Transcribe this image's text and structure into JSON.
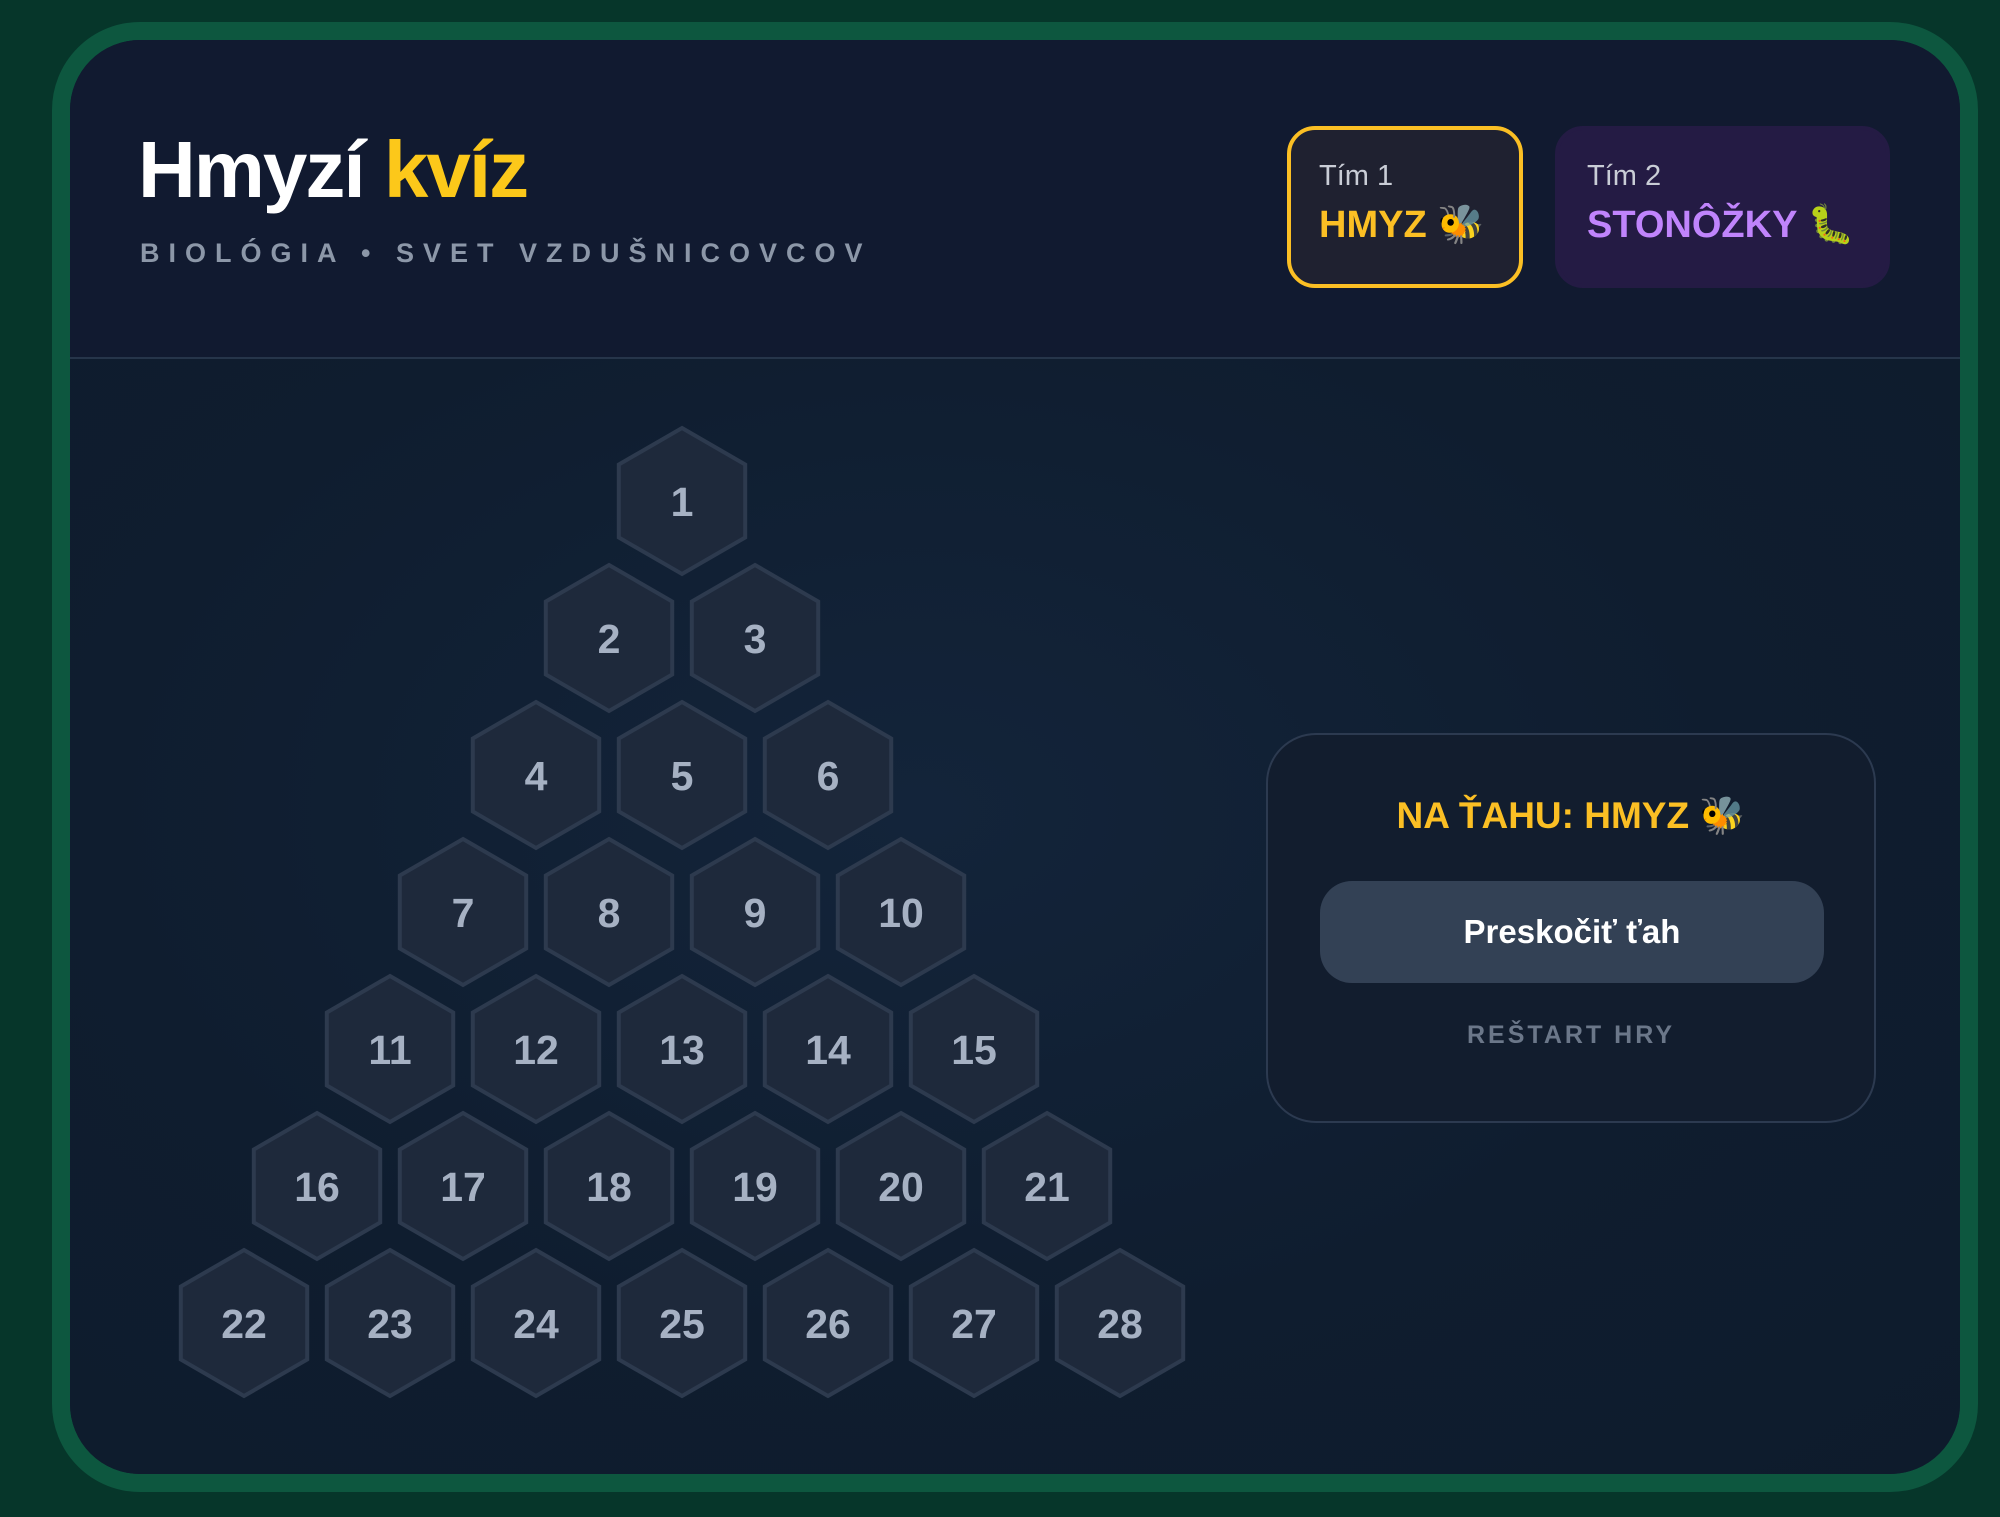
{
  "header": {
    "title_main": "Hmyzí",
    "title_accent": "kvíz",
    "subtitle": "BIOLÓGIA • SVET VZDUŠNICOVCOV"
  },
  "teams": [
    {
      "label": "Tím 1",
      "name": "HMYZ",
      "icon": "bee-icon",
      "emoji": "🐝",
      "active": true,
      "color": "#fbbf24"
    },
    {
      "label": "Tím 2",
      "name": "STONÔŽKY",
      "icon": "caterpillar-icon",
      "emoji": "🐛",
      "active": false,
      "color": "#c084fc"
    }
  ],
  "status": {
    "turn_label": "NA ŤAHU: HMYZ",
    "turn_emoji": "🐝",
    "skip_label": "Preskočiť ťah",
    "restart_label": "REŠTART HRY"
  },
  "board": {
    "rows": [
      [
        "1"
      ],
      [
        "2",
        "3"
      ],
      [
        "4",
        "5",
        "6"
      ],
      [
        "7",
        "8",
        "9",
        "10"
      ],
      [
        "11",
        "12",
        "13",
        "14",
        "15"
      ],
      [
        "16",
        "17",
        "18",
        "19",
        "20",
        "21"
      ],
      [
        "22",
        "23",
        "24",
        "25",
        "26",
        "27",
        "28"
      ]
    ],
    "hex_fill": "#1e293b",
    "hex_stroke": "#2d3a4e",
    "number_color": "#a6b1c3"
  }
}
